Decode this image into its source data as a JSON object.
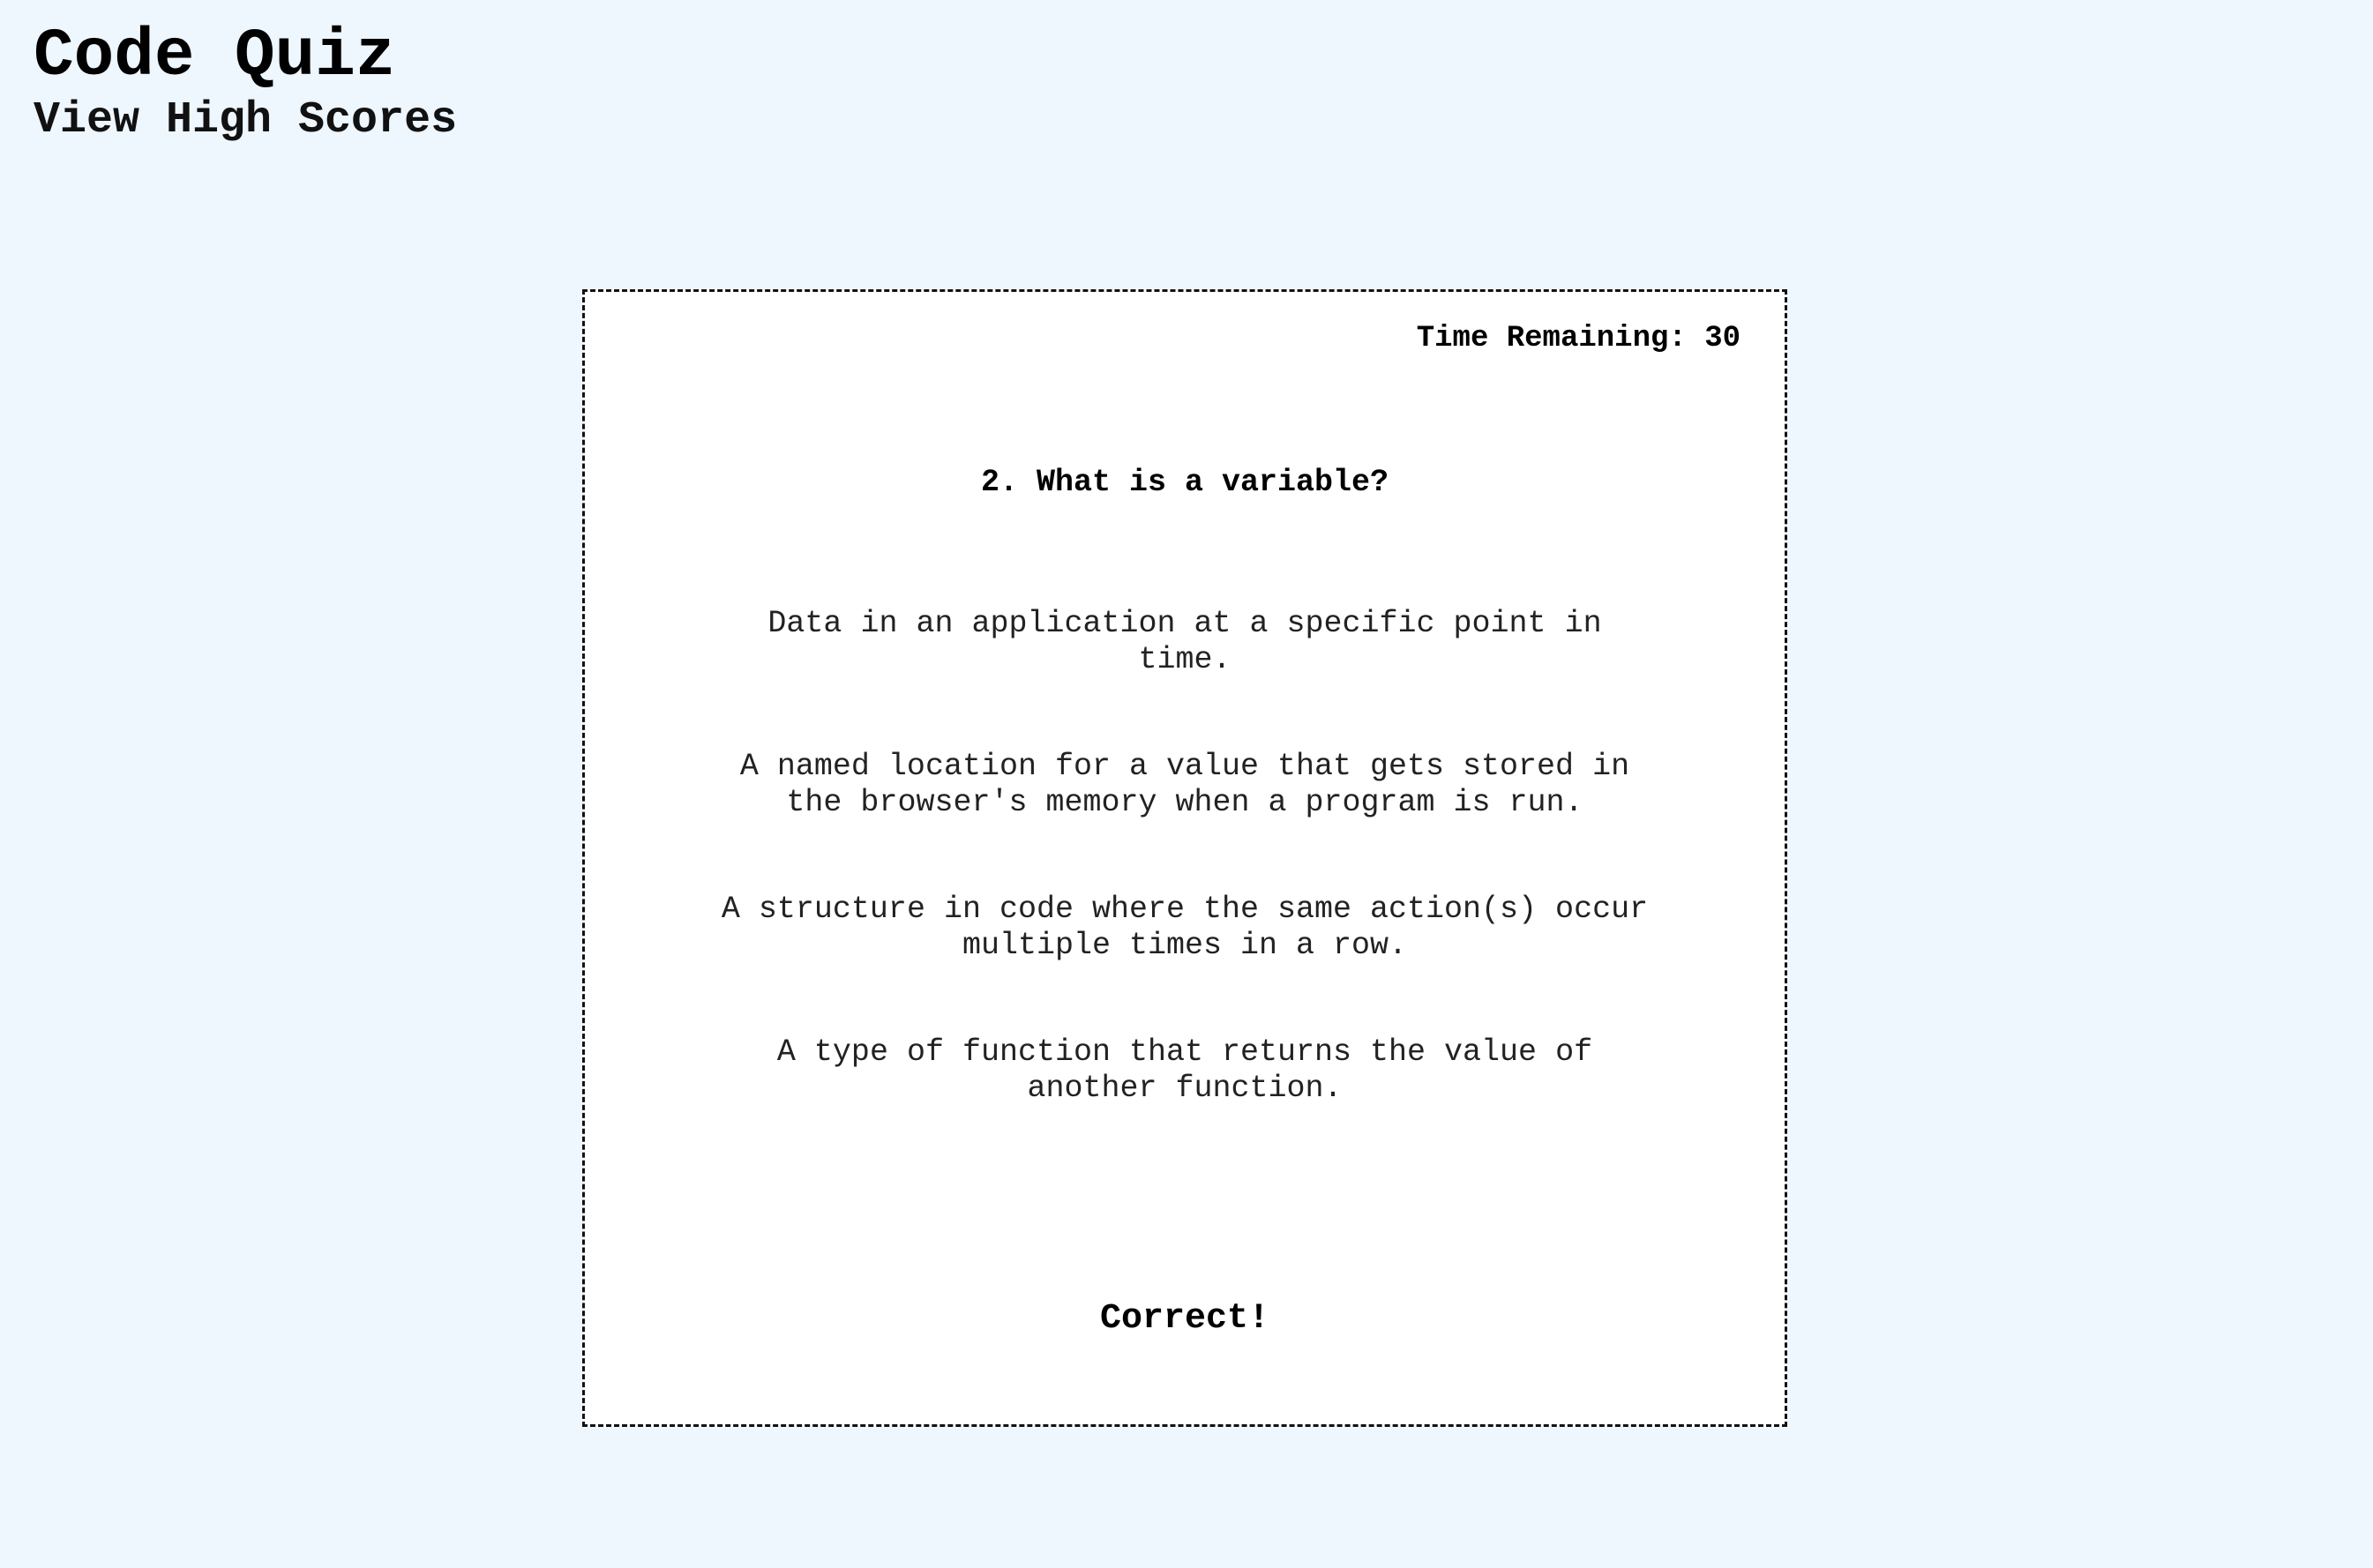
{
  "header": {
    "title": "Code Quiz",
    "high_scores_link": "View High Scores"
  },
  "quiz": {
    "timer_label": "Time Remaining: ",
    "timer_value": "30",
    "question": "2. What is a variable?",
    "answers": [
      {
        "text": "Data in an application at a specific point in time."
      },
      {
        "text": "A named location for a value that gets stored in the browser's memory when a program is run."
      },
      {
        "text": "A structure in code where the same action(s) occur multiple times in a row."
      },
      {
        "text": "A type of function that returns the value of another function."
      }
    ],
    "feedback": "Correct!"
  },
  "colors": {
    "page_background": "#eef6fe",
    "card_background": "#ffffff",
    "border": "#111111"
  }
}
